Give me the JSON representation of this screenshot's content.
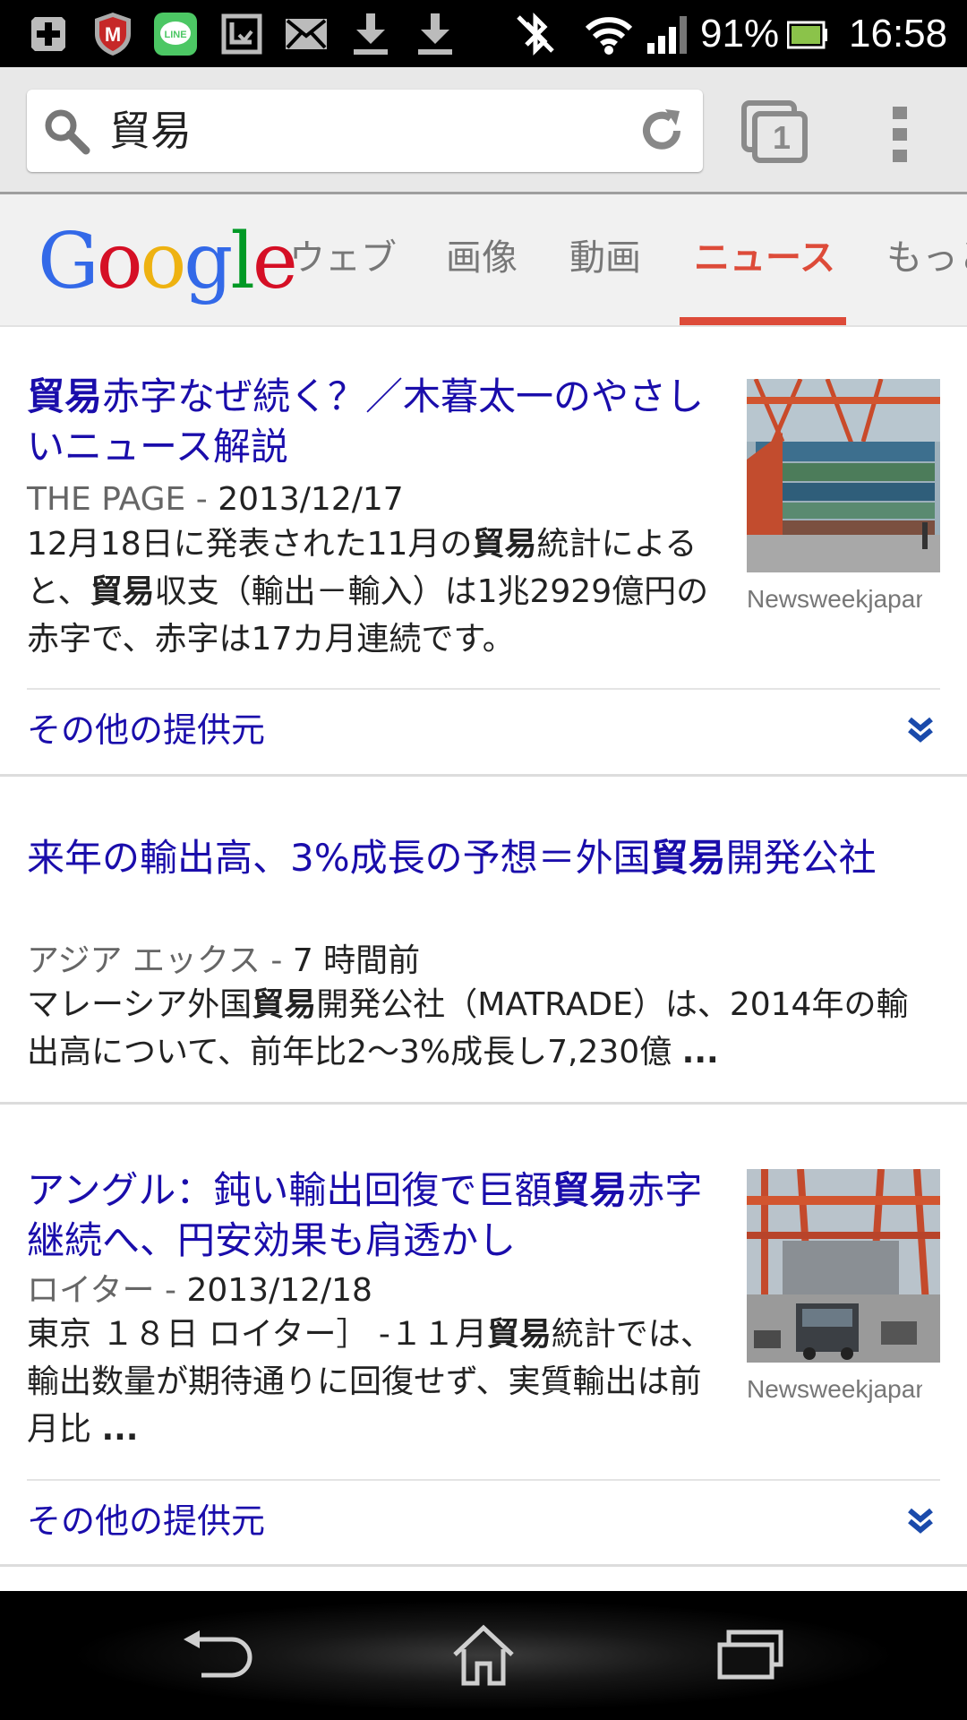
{
  "status_bar": {
    "battery_percent": "91%",
    "time": "16:58",
    "notification_icons": [
      "plus-icon",
      "mcafee-icon",
      "line-app-icon",
      "download-manager-icon",
      "mail-icon",
      "download-icon",
      "download-icon"
    ],
    "system_icons": [
      "bluetooth-off-icon",
      "wifi-icon",
      "signal-icon",
      "battery-icon"
    ]
  },
  "omnibox": {
    "query": "貿易"
  },
  "tab_switcher": {
    "count": "1"
  },
  "google_header": {
    "logo_letters": [
      {
        "char": "G",
        "color": "#3369e8"
      },
      {
        "char": "o",
        "color": "#d50f25"
      },
      {
        "char": "o",
        "color": "#eeb211"
      },
      {
        "char": "g",
        "color": "#3369e8"
      },
      {
        "char": "l",
        "color": "#009925"
      },
      {
        "char": "e",
        "color": "#d50f25"
      }
    ],
    "tabs": [
      {
        "label": "ウェブ",
        "active": false
      },
      {
        "label": "画像",
        "active": false
      },
      {
        "label": "動画",
        "active": false
      },
      {
        "label": "ニュース",
        "active": true
      },
      {
        "label": "もっと",
        "active": false
      }
    ]
  },
  "results": [
    {
      "title_parts": [
        {
          "text": "貿易",
          "bold": true
        },
        {
          "text": "赤字なぜ続く？／木暮太一のやさしいニュース解説",
          "bold": false
        }
      ],
      "source": "THE PAGE",
      "date": "2013/12/17",
      "snippet_parts": [
        {
          "text": "12月18日に発表された11月の",
          "bold": false
        },
        {
          "text": "貿易",
          "bold": true
        },
        {
          "text": "統計によると、",
          "bold": false
        },
        {
          "text": "貿易",
          "bold": true
        },
        {
          "text": "収支（輸出－輸入）は1兆2929億円の赤字で、赤字は17カ月連続です。",
          "bold": false
        }
      ],
      "thumbnail_caption": "Newsweekjapan",
      "more_sources_label": "その他の提供元"
    },
    {
      "title_parts": [
        {
          "text": "来年の輸出高、3%成長の予想＝外国",
          "bold": false
        },
        {
          "text": "貿易",
          "bold": true
        },
        {
          "text": "開発公社",
          "bold": false
        }
      ],
      "source": "アジア エックス",
      "date": "7 時間前",
      "snippet_parts": [
        {
          "text": "マレーシア外国",
          "bold": false
        },
        {
          "text": "貿易",
          "bold": true
        },
        {
          "text": "開発公社（MATRADE）は、2014年の輸出高について、前年比2～3%成長し7,230億 ",
          "bold": false
        },
        {
          "text": "...",
          "bold": true
        }
      ]
    },
    {
      "title_parts": [
        {
          "text": "アングル：鈍い輸出回復で巨額",
          "bold": false
        },
        {
          "text": "貿易",
          "bold": true
        },
        {
          "text": "赤字継続へ、円安効果も肩透かし",
          "bold": false
        }
      ],
      "source": "ロイター",
      "date": "2013/12/18",
      "snippet_parts": [
        {
          "text": "東京 １８日 ロイター］ -１１月",
          "bold": false
        },
        {
          "text": "貿易",
          "bold": true
        },
        {
          "text": "統計では、輸出数量が期待通りに回復せず、実質輸出は前月比 ",
          "bold": false
        },
        {
          "text": "...",
          "bold": true
        }
      ],
      "thumbnail_caption": "Newsweekjapan",
      "more_sources_label": "その他の提供元"
    }
  ],
  "nav_bar": {
    "buttons": [
      "back-icon",
      "home-icon",
      "recent-apps-icon"
    ]
  }
}
